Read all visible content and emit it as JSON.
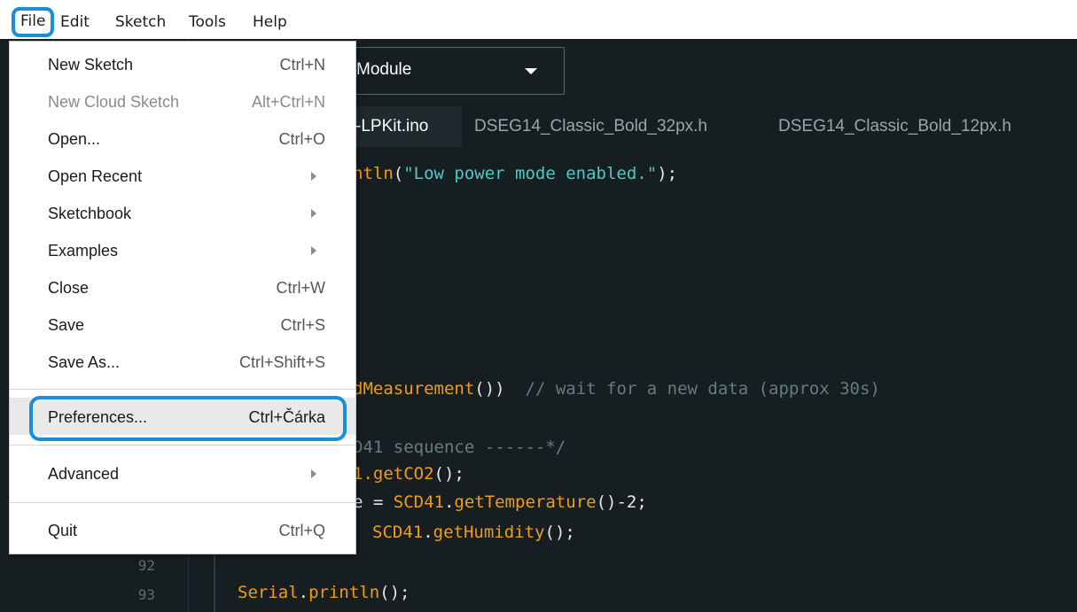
{
  "menubar": {
    "file": "File",
    "edit": "Edit",
    "sketch": "Sketch",
    "tools": "Tools",
    "help": "Help"
  },
  "toolbar": {
    "board": "Module"
  },
  "tabs": [
    {
      "label": "-LPKit.ino"
    },
    {
      "label": "DSEG14_Classic_Bold_32px.h"
    },
    {
      "label": "DSEG14_Classic_Bold_12px.h"
    }
  ],
  "file_menu": {
    "items": [
      {
        "label": "New Sketch",
        "shortcut": "Ctrl+N"
      },
      {
        "label": "New Cloud Sketch",
        "shortcut": "Alt+Ctrl+N"
      },
      {
        "label": "Open...",
        "shortcut": "Ctrl+O"
      },
      {
        "label": "Open Recent",
        "shortcut": ""
      },
      {
        "label": "Sketchbook",
        "shortcut": ""
      },
      {
        "label": "Examples",
        "shortcut": ""
      },
      {
        "label": "Close",
        "shortcut": "Ctrl+W"
      },
      {
        "label": "Save",
        "shortcut": "Ctrl+S"
      },
      {
        "label": "Save As...",
        "shortcut": "Ctrl+Shift+S"
      },
      {
        "label": "Preferences...",
        "shortcut": "Ctrl+Čárka"
      },
      {
        "label": "Advanced",
        "shortcut": ""
      },
      {
        "label": "Quit",
        "shortcut": "Ctrl+Q"
      }
    ]
  },
  "editor": {
    "line_numbers": [
      "92",
      "93"
    ],
    "code": {
      "l1_fn": "ntln",
      "l1_str": "\"Low power mode enabled.\"",
      "l1_rest": ");",
      "l2_fn": "dMeasurement",
      "l2_rest": "())",
      "l2_comment": "// wait for a new data (approx 30s)",
      "l3_comment": "D41 sequence ------*/",
      "l4_a": "1.",
      "l4_fn": "getCO2",
      "l4_rest": "();",
      "l5_a": "e = ",
      "l5_cls": "SCD41",
      "l5_dot": ".",
      "l5_fn": "getTemperature",
      "l5_rest": "()-2;",
      "l6_cls": "SCD41",
      "l6_dot": ".",
      "l6_fn": "getHumidity",
      "l6_rest": "();",
      "l7_cls": "Serial",
      "l7_dot": ".",
      "l7_fn": "println",
      "l7_rest": "();"
    }
  }
}
